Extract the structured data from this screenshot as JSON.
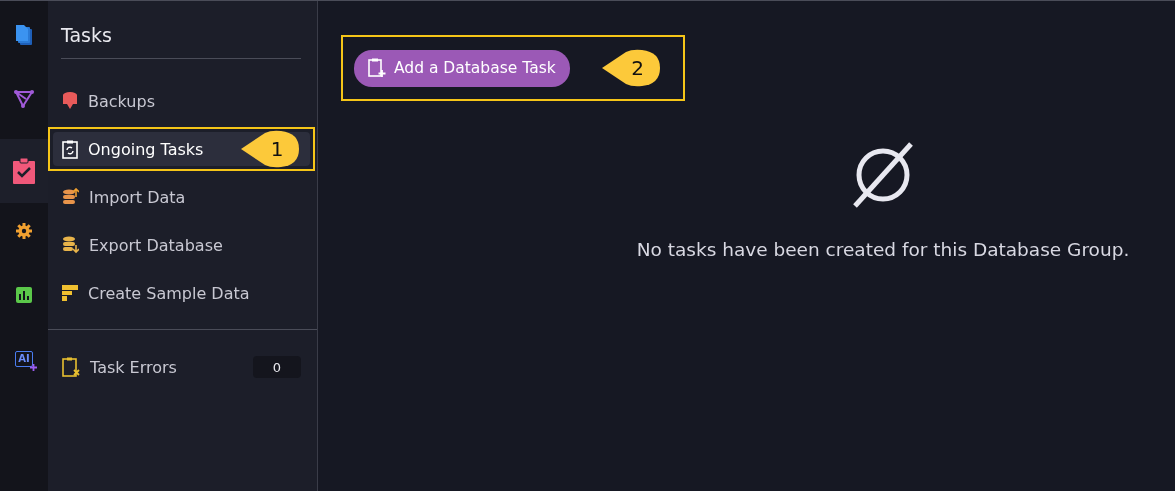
{
  "rail": [
    {
      "kind": "documents",
      "selected": false
    },
    {
      "kind": "graph",
      "selected": false
    },
    {
      "kind": "tasks",
      "selected": true
    },
    {
      "kind": "settings",
      "selected": false
    },
    {
      "kind": "stats",
      "selected": false
    },
    {
      "kind": "ai",
      "selected": false,
      "text": "AI"
    }
  ],
  "sidebar": {
    "title": "Tasks",
    "items": [
      {
        "kind": "backups",
        "label": "Backups",
        "selected": false
      },
      {
        "kind": "ongoing",
        "label": "Ongoing Tasks",
        "selected": true,
        "callout": "1"
      },
      {
        "kind": "import",
        "label": "Import Data",
        "selected": false
      },
      {
        "kind": "export",
        "label": "Export Database",
        "selected": false
      },
      {
        "kind": "sample",
        "label": "Create Sample Data",
        "selected": false
      }
    ],
    "errors": {
      "label": "Task Errors",
      "count": "0"
    }
  },
  "main": {
    "add_button": {
      "label": "Add a Database Task",
      "callout": "2"
    },
    "empty_message": "No tasks have been created for this Database Group."
  }
}
